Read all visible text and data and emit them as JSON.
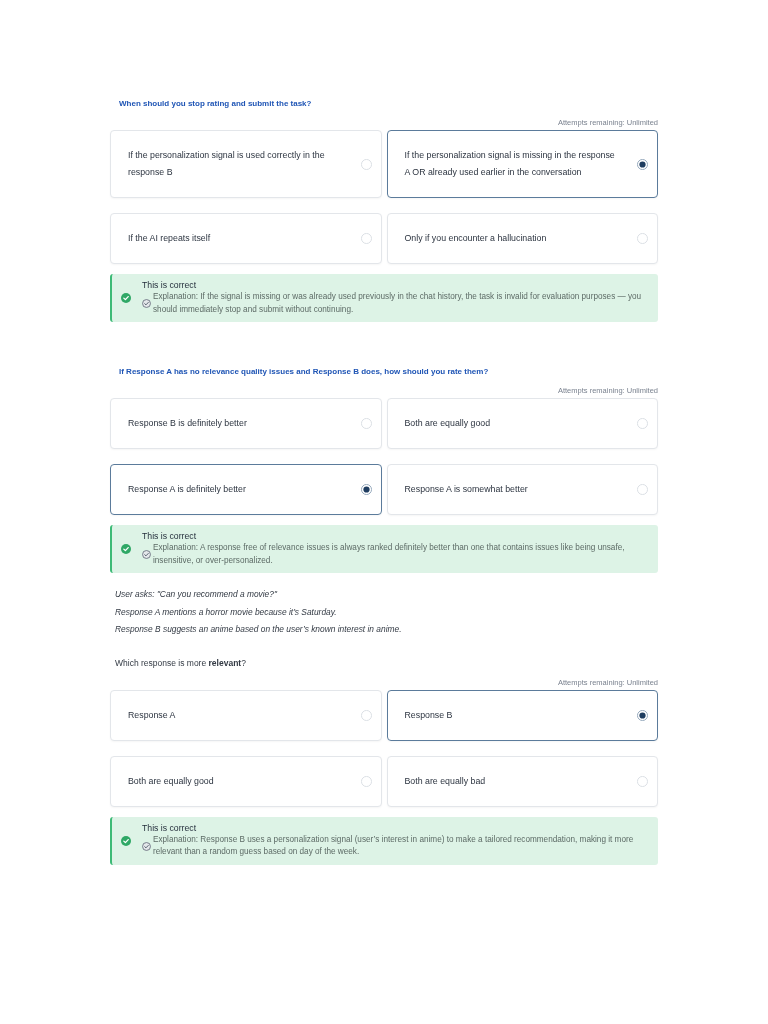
{
  "questions": [
    {
      "kind": "heading",
      "prompt": "When should you stop rating and submit the task?",
      "attempts": "Attempts remaining: Unlimited",
      "options": [
        {
          "label": "If the personalization signal is used correctly in the response B",
          "selected": false
        },
        {
          "label": "If the personalization signal is missing in the response A OR already used earlier in the conversation",
          "selected": true
        },
        {
          "label": "If the AI repeats itself",
          "selected": false
        },
        {
          "label": "Only if you encounter a hallucination",
          "selected": false
        }
      ],
      "feedback": {
        "correct": true,
        "title": "This is correct",
        "explanation": "Explanation: If the signal is missing or was already used previously in the chat history, the task is invalid for evaluation purposes — you should immediately stop and submit without continuing."
      }
    },
    {
      "kind": "heading",
      "prompt": "If Response A has no relevance quality issues and Response B does, how should you rate them?",
      "attempts": "Attempts remaining: Unlimited",
      "options": [
        {
          "label": "Response B is definitely better",
          "selected": false
        },
        {
          "label": "Both are equally good",
          "selected": false
        },
        {
          "label": "Response A is definitely better",
          "selected": true
        },
        {
          "label": "Response A is somewhat better",
          "selected": false
        }
      ],
      "feedback": {
        "correct": true,
        "title": "This is correct",
        "explanation": "Explanation: A response free of relevance issues is always ranked definitely better than one that contains issues like being unsafe, insensitive, or over-personalized."
      }
    },
    {
      "kind": "scenario",
      "context": [
        "User asks: \"Can you recommend a movie?\"",
        "Response A mentions a horror movie because it’s Saturday.",
        "Response B suggests an anime based on the user’s known interest in anime."
      ],
      "prompt": "Which response is more **relevant**?",
      "attempts": "Attempts remaining: Unlimited",
      "options": [
        {
          "label": "Response A",
          "selected": false
        },
        {
          "label": "Response B",
          "selected": true
        },
        {
          "label": "Both are equally good",
          "selected": false
        },
        {
          "label": "Both are equally bad",
          "selected": false
        }
      ],
      "feedback": {
        "correct": true,
        "title": "This is correct",
        "explanation": "Explanation: Response B uses a personalization signal (user’s interest in anime) to make a tailored recommendation, making it more relevant than a random guess based on day of the week."
      }
    }
  ]
}
